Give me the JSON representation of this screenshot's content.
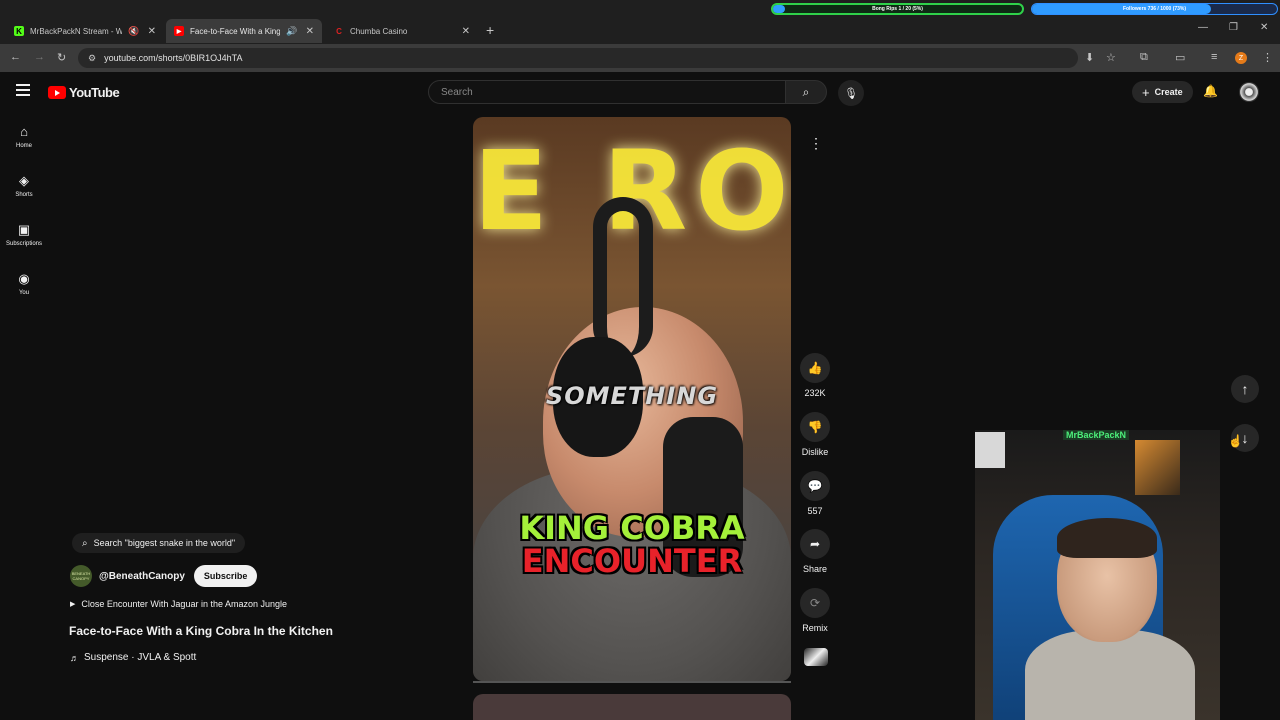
{
  "browser": {
    "tabs": [
      {
        "title": "MrBackPackN Stream - Wa",
        "fav_color": "#53fc18",
        "fav_letter": "K"
      },
      {
        "title": "Face-to-Face With a King C",
        "fav_color": "#ff0000",
        "fav_letter": "▶"
      },
      {
        "title": "Chumba Casino",
        "fav_color": "#d22",
        "fav_letter": "C"
      }
    ],
    "url": "youtube.com/shorts/0BIR1OJ4hTA",
    "profile_letter": "Z",
    "overlay_goal_1": "Bong Rips 1 / 20 (5%)",
    "overlay_goal_1_progress": 0.05,
    "overlay_goal_2": "Followers 736 / 1000 (73%)",
    "overlay_goal_2_progress": 0.73
  },
  "youtube": {
    "logo_text": "YouTube",
    "search_placeholder": "Search",
    "create_label": "Create",
    "guide": [
      {
        "label": "Home",
        "icon": "⌂"
      },
      {
        "label": "Shorts",
        "icon": "◈"
      },
      {
        "label": "Subscriptions",
        "icon": "▣"
      },
      {
        "label": "You",
        "icon": "◉"
      }
    ]
  },
  "short": {
    "caption_mid": "SOMETHING",
    "caption_line1": "KING COBRA",
    "caption_line2": "ENCOUNTER",
    "sign_text": "E ROG",
    "likes": "232K",
    "dislike_label": "Dislike",
    "comments": "557",
    "share_label": "Share",
    "remix_label": "Remix",
    "search_chip": "Search \"biggest snake in the world\"",
    "channel": "@BeneathCanopy",
    "channel_avatar_text": "BENEATH CANOPY",
    "subscribe_label": "Subscribe",
    "related": "Close Encounter With Jaguar in the Amazon Jungle",
    "title": "Face-to-Face With a King Cobra In the Kitchen",
    "music": "Suspense · JVLA & Spott"
  },
  "webcam": {
    "streamer_name": "MrBackPackN"
  }
}
